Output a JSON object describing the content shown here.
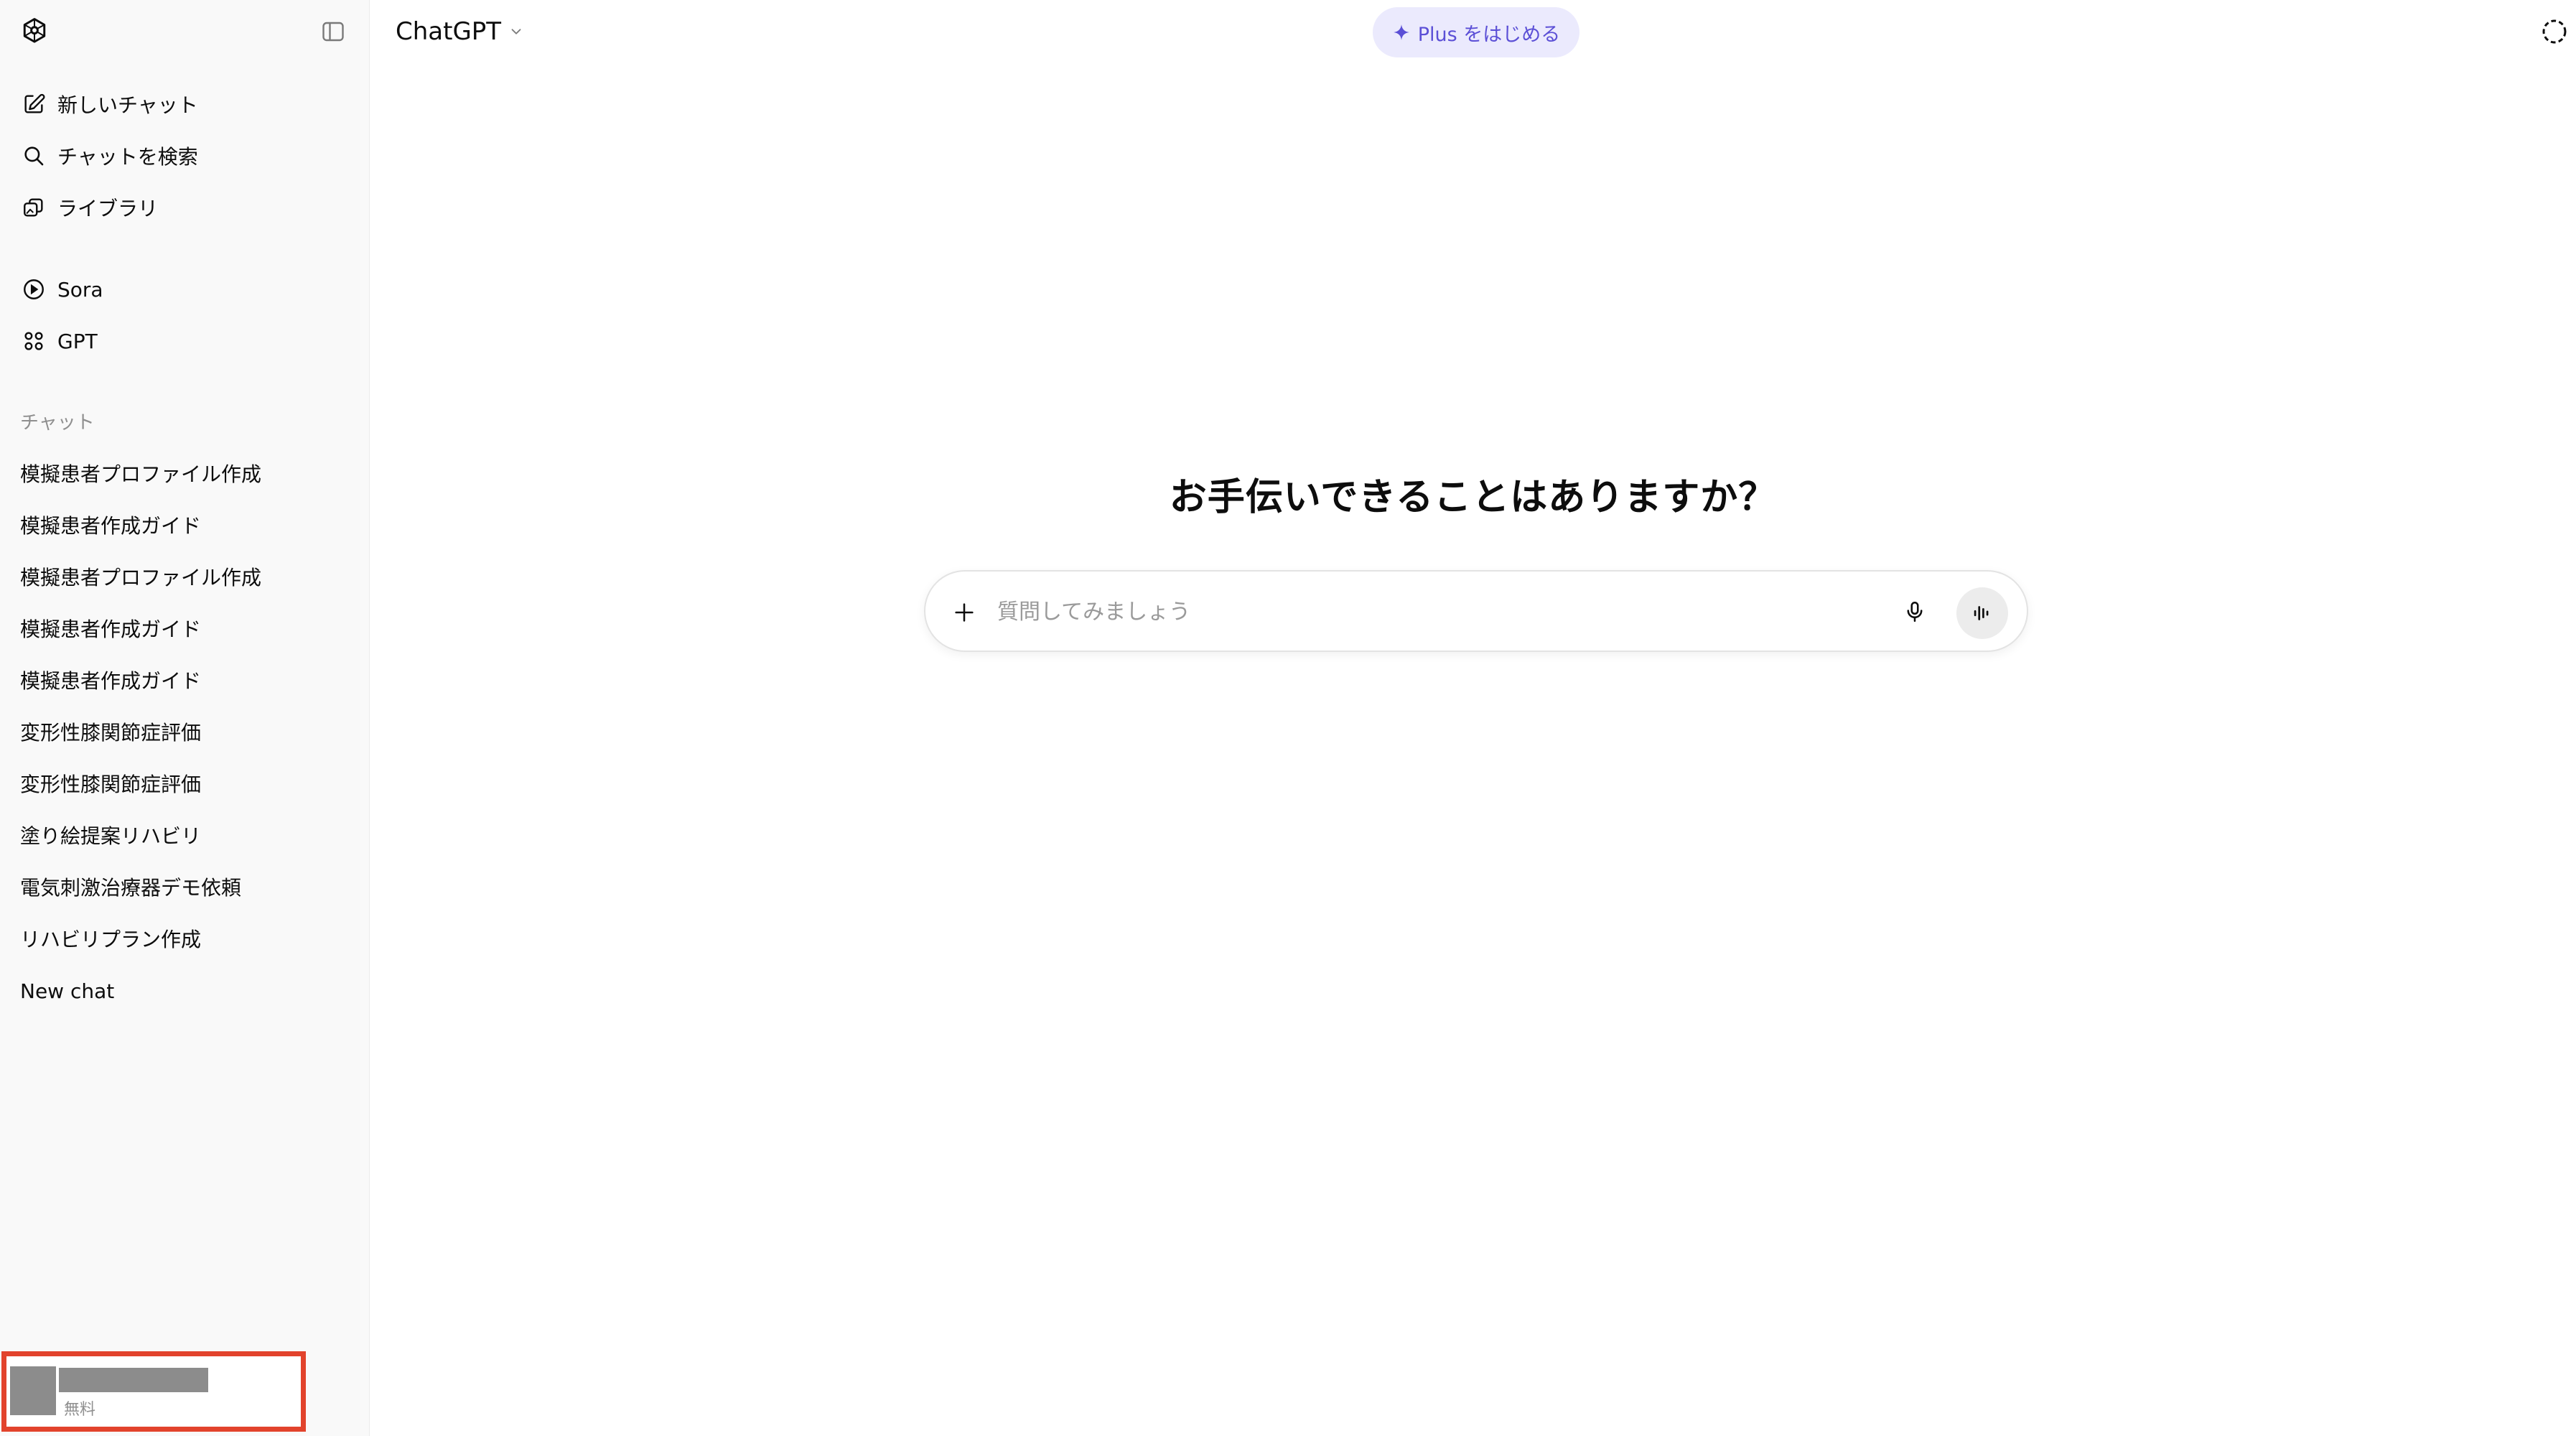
{
  "sidebar": {
    "actions": [
      {
        "label": "新しいチャット",
        "icon": "new-chat-icon"
      },
      {
        "label": "チャットを検索",
        "icon": "search-icon"
      },
      {
        "label": "ライブラリ",
        "icon": "library-icon"
      }
    ],
    "apps": [
      {
        "label": "Sora",
        "icon": "play-circle-icon"
      },
      {
        "label": "GPT",
        "icon": "gpt-grid-icon"
      }
    ],
    "chats_title": "チャット",
    "chats": [
      "模擬患者プロファイル作成",
      "模擬患者作成ガイド",
      "模擬患者プロファイル作成",
      "模擬患者作成ガイド",
      "模擬患者作成ガイド",
      "変形性膝関節症評価",
      "変形性膝関節症評価",
      "塗り絵提案リハビリ",
      "電気刺激治療器デモ依頼",
      "リハビリプラン作成",
      "New chat"
    ],
    "user": {
      "plan": "無料"
    }
  },
  "header": {
    "model_name": "ChatGPT",
    "upgrade_label": "Plus をはじめる"
  },
  "main": {
    "headline": "お手伝いできることはありますか？",
    "composer": {
      "placeholder": "質問してみましょう",
      "value": ""
    }
  },
  "colors": {
    "sidebar_bg": "#f9f9f9",
    "accent": "#5b4fd6",
    "pill_bg": "#ebeafd",
    "highlight_box": "#e2432c"
  }
}
